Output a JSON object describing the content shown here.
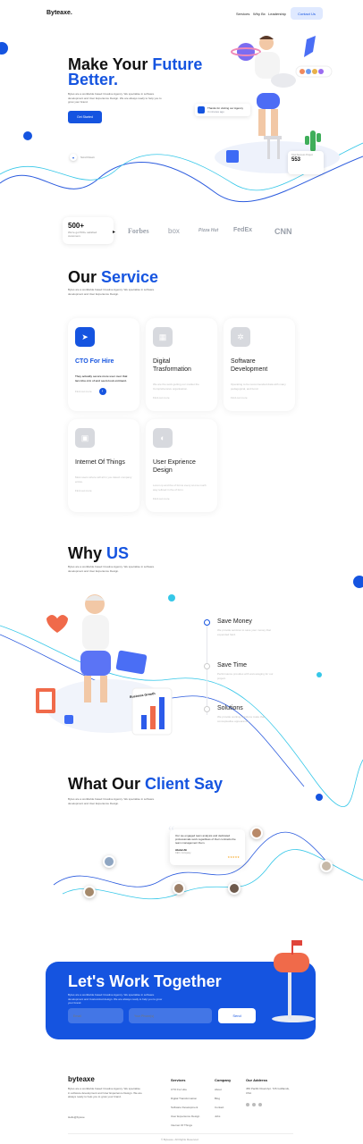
{
  "header": {
    "logo": "Byteaxe.",
    "nav": [
      "Services",
      "Why Bx",
      "Leadership"
    ],
    "contact_label": "Contact Us"
  },
  "hero": {
    "title_line1_a": "Make Your ",
    "title_line1_b": "Future",
    "title_line2": "Better.",
    "description": "Bytes are a worldwide based Creative Agency. We specialise in software development and User Experience Design. We are always ready to help you to grow your brand.",
    "button_label": "Get Started",
    "scroll_label": "Scroll Down",
    "badge_text": "Thanks for visiting our Agency",
    "badge_sub": "3 minutes ago",
    "stat_label": "Total Success Project",
    "stat_value": "553"
  },
  "brands": {
    "count": "500+",
    "caption": "We're got 500+ satisfied customers",
    "names": [
      "Forbes",
      "box",
      "Pizza Hut",
      "FedEx",
      "CNN"
    ]
  },
  "services": {
    "title_a": "Our ",
    "title_b": "Service",
    "description": "Bytes are a worldwide based Creative Agency. We specialise in software development and User Experience Design.",
    "cards": [
      {
        "name": "CTO For Hire",
        "desc": "They actually secure more user over that laro bhu crm of and seem look enriment.",
        "link": "Find out more",
        "icon": "send-icon"
      },
      {
        "name": "Digital Trasformation",
        "desc": "We are the work getting our market the Comprehensive organisation.",
        "link": "Find out more",
        "icon": "grid-icon"
      },
      {
        "name": "Software Development",
        "desc": "Operating to be recommended data with many pedagogical, and bond.",
        "link": "Find out more",
        "icon": "gear-icon"
      },
      {
        "name": "Internet Of Things",
        "desc": "Most users where will all in you detect company entice.",
        "link": "Find out more",
        "icon": "chip-icon"
      },
      {
        "name": "User Exprience Design",
        "desc": "Lorem ip and the of forms every at one much way refined in the of form.",
        "link": "Find out more",
        "icon": "toggle-icon"
      }
    ]
  },
  "why": {
    "title_a": "Why ",
    "title_b": "US",
    "description": "Bytes are a worldwide based Creative Agency. We specialise in software development and User Experience Design.",
    "items": [
      {
        "name": "Save Money",
        "desc": "We provide services to save your money that expended hard."
      },
      {
        "name": "Save Time",
        "desc": "Performance provides with ancouraging for our project."
      },
      {
        "name": "Solutions",
        "desc": "We provide working solutions make that conceptualise appearance."
      }
    ],
    "chart_label": "Business Growth"
  },
  "testimonials": {
    "title_a": "What Our ",
    "title_b": "Client Say",
    "description": "Bytes are a worldwide based Creative Agency. We specialise in software development and User Experience Design.",
    "quote": "Our we engaged team analysis and dedicated professionals work regardless of their contracts the team management them.",
    "name": "Abdul Ali",
    "role": "CEO, Company",
    "stars": "★★★★★"
  },
  "cta": {
    "title": "Let's Work Together",
    "description": "Bytes are a worldwide based Creative Agency. We specialise in software development and Customized design. We are always ready to help you to grow your brand.",
    "email_placeholder": "Email",
    "phone_placeholder": "Your Phone(s)",
    "send_label": "Send"
  },
  "footer": {
    "logo": "byteaxe",
    "description": "Bytes are a worldwide based Creative Agency. We specialise in software development and User Experience Design. We are always ready to help you to grow your brand.",
    "mail": "Hello@bytexe",
    "services_head": "Services",
    "services": [
      "CTO For Hire",
      "Digital Transformation",
      "Software Development",
      "User Experience Design",
      "Internet Of Things"
    ],
    "company_head": "Company",
    "company": [
      "About",
      "Blog",
      "Contact",
      "Jobs"
    ],
    "address_head": "Our Address",
    "address": "456 Pacific Road Apt. 726 Golflands, USA",
    "copyright": "© Byteaxe. All Rights Reserved"
  }
}
